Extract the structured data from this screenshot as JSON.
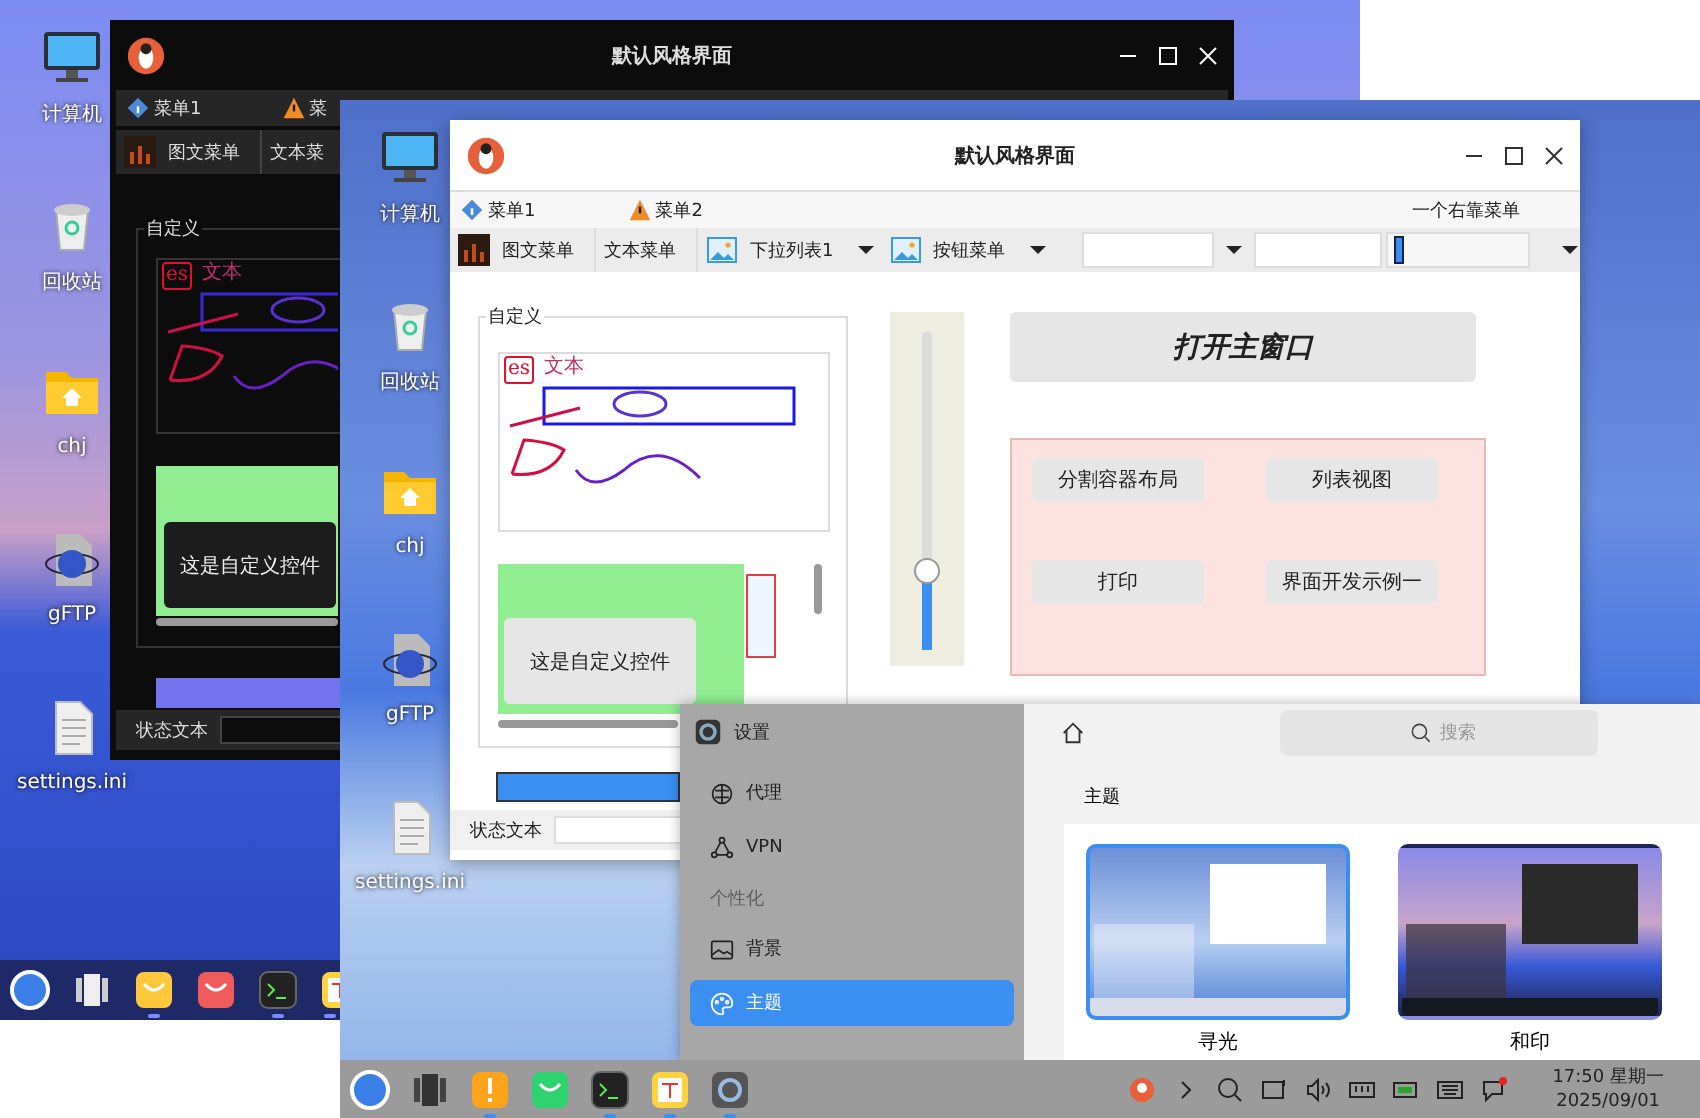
{
  "left_screen": {
    "desktop_icons": [
      {
        "kind": "computer",
        "label": "计算机"
      },
      {
        "kind": "trash",
        "label": "回收站"
      },
      {
        "kind": "folder",
        "label": "chj"
      },
      {
        "kind": "ftp",
        "label": "gFTP"
      },
      {
        "kind": "file",
        "label": "settings.ini"
      }
    ],
    "window": {
      "title": "默认风格界面",
      "menus": [
        "菜单1",
        "菜"
      ],
      "toolbar": [
        {
          "kind": "image",
          "label": "图文菜单"
        },
        {
          "kind": "text",
          "label": "文本菜"
        }
      ],
      "group_title": "自定义",
      "canvas_texts": [
        "es",
        "文本"
      ],
      "custom_control": "这是自定义控件",
      "progress": {
        "level": 1
      },
      "status_label": "状态文本"
    },
    "taskbar": {
      "apps": [
        {
          "kind": "launcher",
          "running": false
        },
        {
          "kind": "multitask",
          "running": false
        },
        {
          "kind": "files",
          "running": true
        },
        {
          "kind": "store",
          "running": false
        },
        {
          "kind": "terminal",
          "running": true
        },
        {
          "kind": "notes",
          "running": true
        }
      ]
    }
  },
  "right_screen": {
    "desktop_icons": [
      {
        "kind": "computer",
        "label": "计算机"
      },
      {
        "kind": "trash",
        "label": "回收站"
      },
      {
        "kind": "folder",
        "label": "chj"
      },
      {
        "kind": "ftp",
        "label": "gFTP"
      },
      {
        "kind": "file",
        "label": "settings.ini"
      }
    ],
    "window": {
      "title": "默认风格界面",
      "menus": [
        "菜单1",
        "菜单2"
      ],
      "right_menu": "一个右靠菜单",
      "toolbar": [
        {
          "kind": "image",
          "label": "图文菜单"
        },
        {
          "kind": "text",
          "label": "文本菜单"
        },
        {
          "kind": "dropdown",
          "label": "下拉列表1"
        },
        {
          "kind": "dropdown",
          "label": "按钮菜单"
        }
      ],
      "toolbar_slider": {
        "level": 0.05
      },
      "group_title": "自定义",
      "canvas_texts": [
        "es",
        "文本"
      ],
      "custom_control": "这是自定义控件",
      "slider": {
        "level": 0.25
      },
      "main_button": "打开主窗口",
      "buttons": [
        "分割容器布局",
        "列表视图",
        "打印",
        "界面开发示例一"
      ],
      "progress": {
        "level": 1
      },
      "status_label": "状态文本"
    },
    "settings": {
      "title": "设置",
      "search_placeholder": "搜索",
      "nav": [
        {
          "kind": "item",
          "label": "代理",
          "selected": false
        },
        {
          "kind": "item",
          "label": "VPN",
          "selected": false
        },
        {
          "kind": "heading",
          "label": "个性化"
        },
        {
          "kind": "item",
          "label": "背景",
          "selected": false
        },
        {
          "kind": "item",
          "label": "主题",
          "selected": true
        }
      ],
      "section_title": "主题",
      "themes": [
        {
          "name": "寻光",
          "selected": true
        },
        {
          "name": "和印",
          "selected": false
        }
      ]
    },
    "taskbar": {
      "apps": [
        {
          "kind": "launcher",
          "running": false
        },
        {
          "kind": "multitask",
          "running": false
        },
        {
          "kind": "exclamation",
          "running": true
        },
        {
          "kind": "store",
          "running": false
        },
        {
          "kind": "terminal",
          "running": true
        },
        {
          "kind": "notes",
          "running": true
        },
        {
          "kind": "settings",
          "running": true
        }
      ],
      "time": "17:50 星期一",
      "date": "2025/09/01"
    }
  }
}
